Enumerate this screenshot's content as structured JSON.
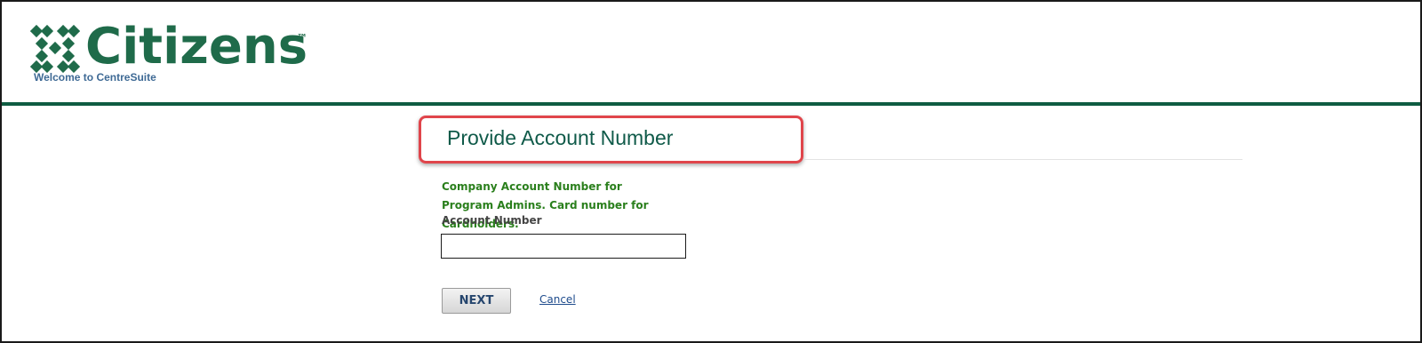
{
  "brand": {
    "name": "Citizens",
    "trademark": "™",
    "tagline": "Welcome to CentreSuite",
    "primary_color": "#1f6b4a",
    "rule_color": "#0e5c42",
    "logo_icon": "citizens-logo-mark-icon"
  },
  "page": {
    "title": "Provide Account Number",
    "highlight_color": "#e0454b"
  },
  "form": {
    "help_text": "Company Account Number for Program Admins. Card number for Cardholders.",
    "account_label": "Account Number",
    "account_value": "",
    "next_label": "NEXT",
    "cancel_label": "Cancel"
  }
}
